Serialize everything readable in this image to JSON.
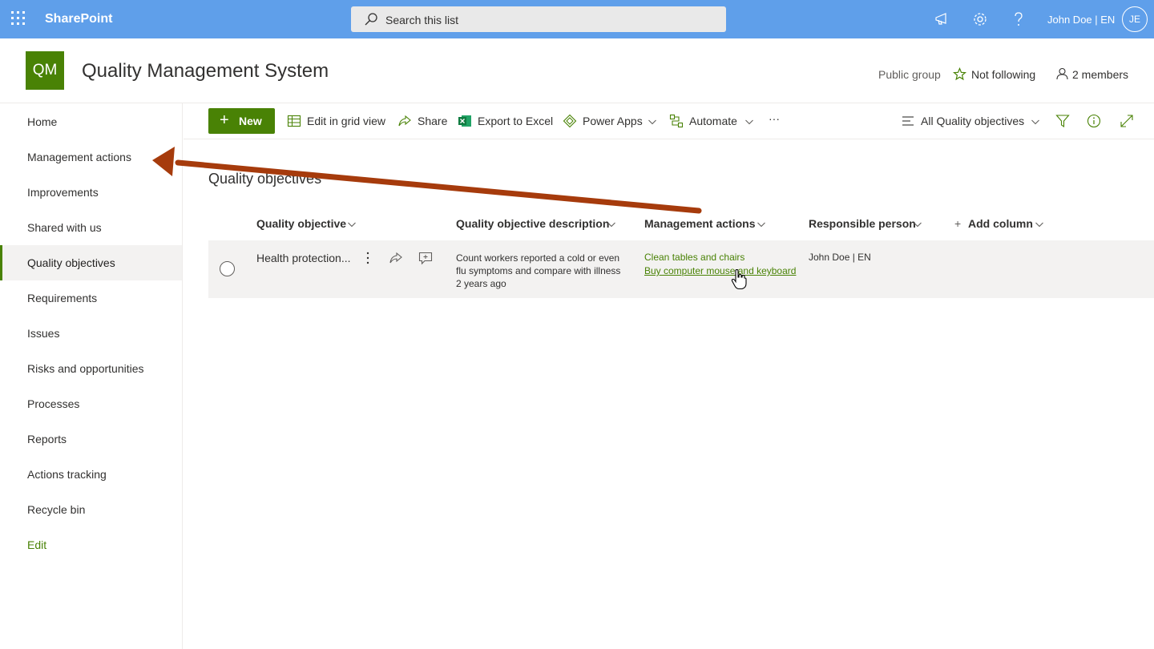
{
  "suite_bar": {
    "app_name": "SharePoint",
    "search_placeholder": "Search this list",
    "user_name": "John Doe | EN",
    "user_initials": "JE",
    "icons": [
      "waffle-icon",
      "megaphone-icon",
      "gear-icon",
      "help-icon"
    ]
  },
  "site": {
    "logo_text": "QM",
    "title": "Quality Management System",
    "privacy": "Public group",
    "follow_label": "Not following",
    "members_label": "2 members",
    "brand_color": "#498205",
    "suitebar_color": "#5f9fea"
  },
  "nav": {
    "items": [
      {
        "label": "Home"
      },
      {
        "label": "Management actions"
      },
      {
        "label": "Improvements"
      },
      {
        "label": "Shared with us"
      },
      {
        "label": "Quality objectives",
        "selected": true
      },
      {
        "label": "Requirements"
      },
      {
        "label": "Issues"
      },
      {
        "label": "Risks and opportunities"
      },
      {
        "label": "Processes"
      },
      {
        "label": "Reports"
      },
      {
        "label": "Actions tracking"
      },
      {
        "label": "Recycle bin"
      }
    ],
    "edit_label": "Edit"
  },
  "command_bar": {
    "new_label": "New",
    "edit_grid_label": "Edit in grid view",
    "share_label": "Share",
    "export_label": "Export to Excel",
    "power_apps_label": "Power Apps",
    "automate_label": "Automate",
    "more_label": "···",
    "view_label": "All Quality objectives"
  },
  "list": {
    "title": "Quality objectives",
    "columns": [
      "Quality objective",
      "Quality objective description",
      "Management actions",
      "Responsible person",
      "Add column"
    ],
    "rows": [
      {
        "title": "Health protection...",
        "description_line1": "Count workers reported a cold or even",
        "description_line2": "flu symptoms and compare with illness",
        "modified": "2 years ago",
        "actions": [
          "Clean tables and chairs",
          "Buy computer mouse and keyboard"
        ],
        "person": "John Doe | EN"
      }
    ]
  },
  "annotation": {
    "arrow_color": "#a63b0c",
    "pointer": "hand-cursor"
  }
}
